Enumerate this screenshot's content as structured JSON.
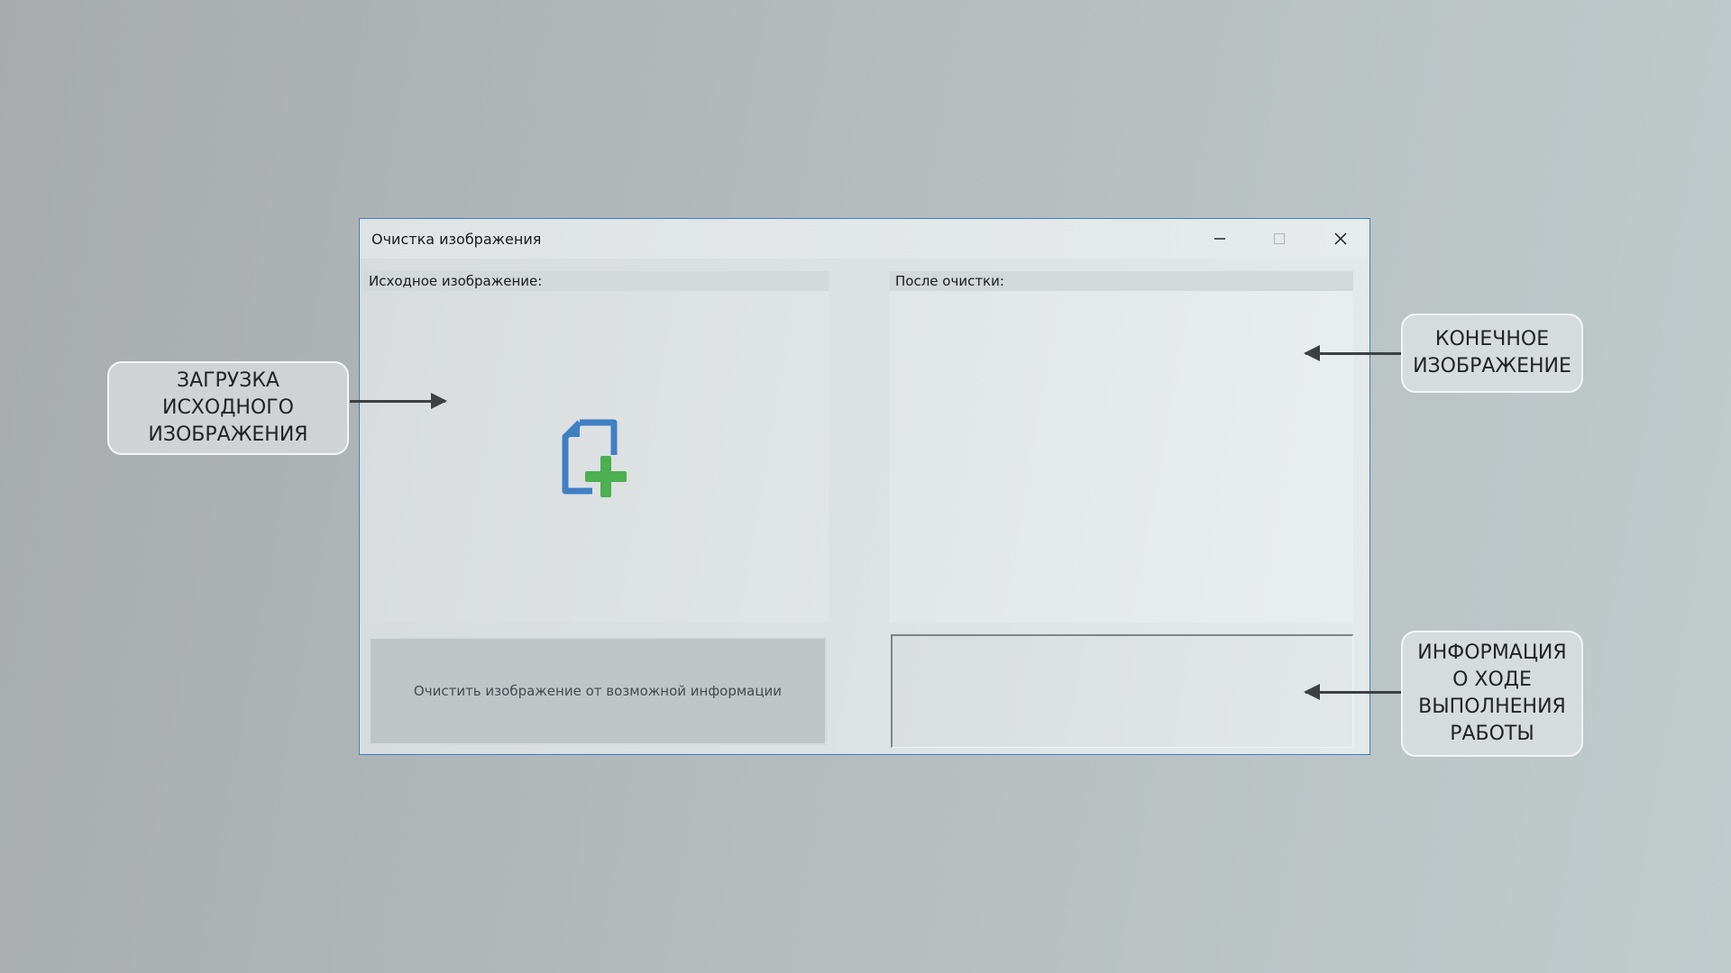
{
  "window": {
    "title": "Очистка изображения",
    "accent_color": "#3d7fc4"
  },
  "window_controls": {
    "minimize_icon": "minimize-icon",
    "maximize_icon": "maximize-icon",
    "close_icon": "close-icon"
  },
  "source_panel": {
    "label": "Исходное изображение:",
    "icon": "add-file-icon",
    "icon_colors": {
      "file": "#3f7fc3",
      "plus": "#4caf50"
    }
  },
  "result_panel": {
    "label": "После очистки:"
  },
  "clean_button": {
    "label": "Очистить изображение от возможной информации"
  },
  "log_area": {
    "text": ""
  },
  "callouts": {
    "load": "ЗАГРУЗКА\nИСХОДНОГО\nИЗОБРАЖЕНИЯ",
    "result": "КОНЕЧНОЕ\nИЗОБРАЖЕНИЕ",
    "info": "ИНФОРМАЦИЯ\nО ХОДЕ\nВЫПОЛНЕНИЯ\nРАБОТЫ"
  }
}
